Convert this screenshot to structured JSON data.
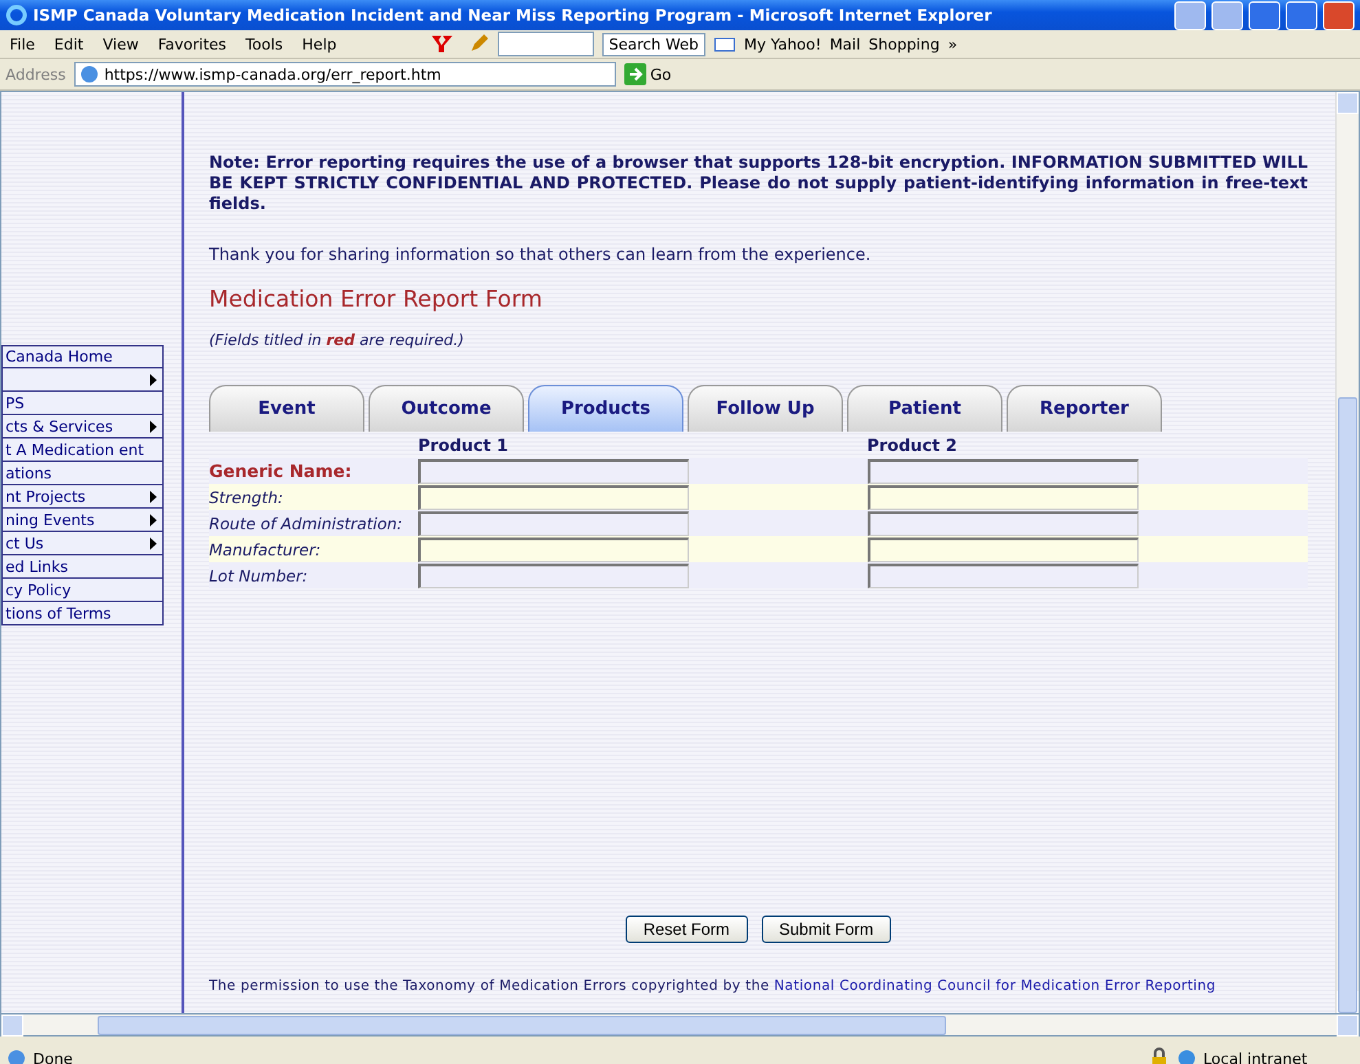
{
  "window": {
    "title": "ISMP Canada Voluntary Medication Incident and Near Miss Reporting Program - Microsoft Internet Explorer"
  },
  "menu": [
    "File",
    "Edit",
    "View",
    "Favorites",
    "Tools",
    "Help"
  ],
  "toolbar": {
    "search_button": "Search Web",
    "links": [
      "My Yahoo!",
      "Mail",
      "Shopping"
    ],
    "more": "»"
  },
  "address": {
    "label": "Address",
    "url": "https://www.ismp-canada.org/err_report.htm",
    "go": "Go"
  },
  "sidebar": {
    "items": [
      {
        "label": "Canada Home",
        "submenu": false
      },
      {
        "submenu": true
      },
      {
        "label": "PS",
        "submenu": false
      },
      {
        "label": "cts & Services",
        "submenu": true
      },
      {
        "label": "t A Medication ent",
        "submenu": false
      },
      {
        "label": "ations",
        "submenu": false
      },
      {
        "label": "nt Projects",
        "submenu": true
      },
      {
        "label": "ning Events",
        "submenu": true
      },
      {
        "label": "ct Us",
        "submenu": true
      },
      {
        "label": "ed Links",
        "submenu": false
      },
      {
        "label": "cy Policy",
        "submenu": false
      },
      {
        "label": "tions of Terms",
        "submenu": false
      }
    ]
  },
  "note": "Note: Error reporting requires the use of a browser that supports 128-bit encryption. INFORMATION SUBMITTED WILL BE KEPT STRICTLY CONFIDENTIAL AND PROTECTED. Please do not supply patient-identifying information in free-text fields.",
  "thanks": "Thank you for sharing information so that others can learn from the experience.",
  "form_title": "Medication Error Report Form",
  "required_note": "(Fields titled in **red** are required.)",
  "tabs": [
    {
      "label": "Event",
      "selected": false
    },
    {
      "label": "Outcome",
      "selected": false
    },
    {
      "label": "Products",
      "selected": true
    },
    {
      "label": "Follow Up",
      "selected": false
    },
    {
      "label": "Patient",
      "selected": false
    },
    {
      "label": "Reporter",
      "selected": false
    }
  ],
  "products": {
    "columns": [
      "Product 1",
      "Product 2"
    ],
    "fields": [
      {
        "label": "Generic Name:",
        "required": true
      },
      {
        "label": "Strength:",
        "required": false
      },
      {
        "label": "Route of Administration:",
        "required": false
      },
      {
        "label": "Manufacturer:",
        "required": false
      },
      {
        "label": "Lot Number:",
        "required": false
      }
    ]
  },
  "buttons": [
    "Reset Form",
    "Submit Form"
  ],
  "footer": {
    "text": "The permission to use the Taxonomy of Medication Errors copyrighted by the",
    "link": "National Coordinating Council for Medication Error Reporting"
  },
  "status_bar": {
    "text": "Done",
    "zone": "Local intranet"
  }
}
